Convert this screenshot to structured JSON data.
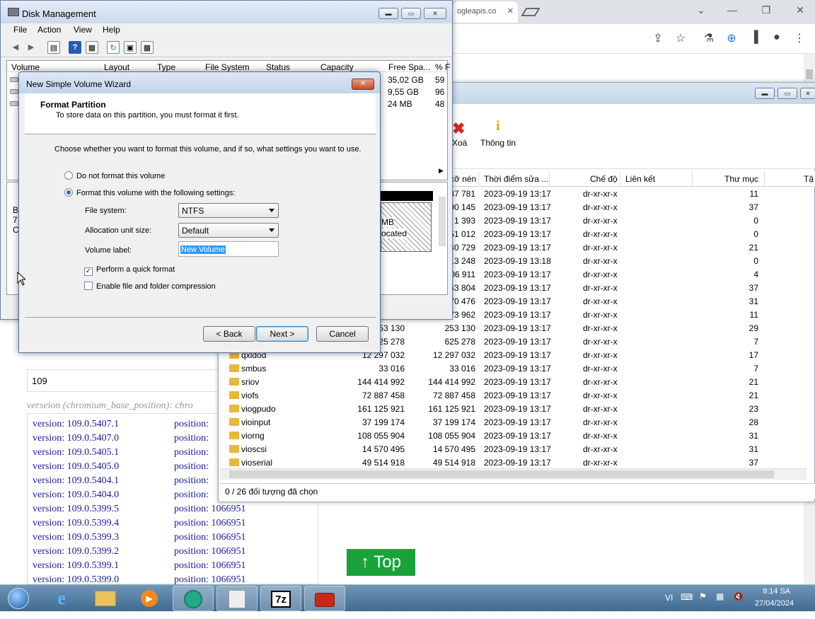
{
  "chrome": {
    "tab_text": "ogleapis.co",
    "controls": [
      "⌄",
      "—",
      "❐",
      "✕"
    ]
  },
  "page": {
    "input_value": "109",
    "italic_header": "verseion (chromium_base_position): chro",
    "versions": [
      {
        "version": "version: 109.0.5407.1",
        "position": "position:"
      },
      {
        "version": "version: 109.0.5407.0",
        "position": "position:"
      },
      {
        "version": "version: 109.0.5405.1",
        "position": "position:"
      },
      {
        "version": "version: 109.0.5405.0",
        "position": "position:"
      },
      {
        "version": "version: 109.0.5404.1",
        "position": "position:"
      },
      {
        "version": "version: 109.0.5404.0",
        "position": "position:"
      },
      {
        "version": "version: 109.0.5399.5",
        "position": "position: 1066951"
      },
      {
        "version": "version: 109.0.5399.4",
        "position": "position: 1066951"
      },
      {
        "version": "version: 109.0.5399.3",
        "position": "position: 1066951"
      },
      {
        "version": "version: 109.0.5399.2",
        "position": "position: 1066951"
      },
      {
        "version": "version: 109.0.5399.1",
        "position": "position: 1066951"
      },
      {
        "version": "version: 109.0.5399.0",
        "position": "position: 1066951"
      }
    ],
    "top_button": "↑ Top"
  },
  "file_manager": {
    "toolbar": {
      "delete_label": "Xoá",
      "info_label": "Thông tin"
    },
    "columns": [
      "cỡ nén",
      "Thời điểm sửa ...",
      "Chế độ",
      "Liên kết",
      "Thư mục",
      "Tậ"
    ],
    "rows_partial": [
      {
        "packed": "37 781",
        "time": "2023-09-19 13:17",
        "mode": "dr-xr-xr-x",
        "folders": "11"
      },
      {
        "packed": "00 145",
        "time": "2023-09-19 13:17",
        "mode": "dr-xr-xr-x",
        "folders": "37"
      },
      {
        "packed": "1 393",
        "time": "2023-09-19 13:17",
        "mode": "dr-xr-xr-x",
        "folders": "0"
      },
      {
        "packed": "51 012",
        "time": "2023-09-19 13:17",
        "mode": "dr-xr-xr-x",
        "folders": "0"
      },
      {
        "packed": "40 729",
        "time": "2023-09-19 13:17",
        "mode": "dr-xr-xr-x",
        "folders": "21"
      },
      {
        "packed": "13 248",
        "time": "2023-09-19 13:18",
        "mode": "dr-xr-xr-x",
        "folders": "0"
      },
      {
        "packed": "06 911",
        "time": "2023-09-19 13:17",
        "mode": "dr-xr-xr-x",
        "folders": "4"
      },
      {
        "packed": "43 804",
        "time": "2023-09-19 13:17",
        "mode": "dr-xr-xr-x",
        "folders": "37"
      },
      {
        "packed": "70 476",
        "time": "2023-09-19 13:17",
        "mode": "dr-xr-xr-x",
        "folders": "31"
      },
      {
        "packed": "73 962",
        "time": "2023-09-19 13:17",
        "mode": "dr-xr-xr-x",
        "folders": "11"
      },
      {
        "size": "253 130",
        "packed": "253 130",
        "time": "2023-09-19 13:17",
        "mode": "dr-xr-xr-x",
        "folders": "29"
      },
      {
        "size": "625 278",
        "packed": "625 278",
        "time": "2023-09-19 13:17",
        "mode": "dr-xr-xr-x",
        "folders": "7"
      }
    ],
    "rows": [
      {
        "name": "qxldod",
        "size": "12 297 032",
        "packed": "12 297 032",
        "time": "2023-09-19 13:17",
        "mode": "dr-xr-xr-x",
        "folders": "17"
      },
      {
        "name": "smbus",
        "size": "33 016",
        "packed": "33 016",
        "time": "2023-09-19 13:17",
        "mode": "dr-xr-xr-x",
        "folders": "7"
      },
      {
        "name": "sriov",
        "size": "144 414 992",
        "packed": "144 414 992",
        "time": "2023-09-19 13:17",
        "mode": "dr-xr-xr-x",
        "folders": "21"
      },
      {
        "name": "viofs",
        "size": "72 887 458",
        "packed": "72 887 458",
        "time": "2023-09-19 13:17",
        "mode": "dr-xr-xr-x",
        "folders": "21"
      },
      {
        "name": "viogpudo",
        "size": "161 125 921",
        "packed": "161 125 921",
        "time": "2023-09-19 13:17",
        "mode": "dr-xr-xr-x",
        "folders": "23"
      },
      {
        "name": "vioinput",
        "size": "37 199 174",
        "packed": "37 199 174",
        "time": "2023-09-19 13:17",
        "mode": "dr-xr-xr-x",
        "folders": "28"
      },
      {
        "name": "viorng",
        "size": "108 055 904",
        "packed": "108 055 904",
        "time": "2023-09-19 13:17",
        "mode": "dr-xr-xr-x",
        "folders": "31"
      },
      {
        "name": "vioscsi",
        "size": "14 570 495",
        "packed": "14 570 495",
        "time": "2023-09-19 13:17",
        "mode": "dr-xr-xr-x",
        "folders": "31"
      },
      {
        "name": "vioserial",
        "size": "49 514 918",
        "packed": "49 514 918",
        "time": "2023-09-19 13:17",
        "mode": "dr-xr-xr-x",
        "folders": "37"
      }
    ],
    "status": "0 / 26 đối tượng đã chọn"
  },
  "disk_management": {
    "title": "Disk Management",
    "menu": [
      "File",
      "Action",
      "View",
      "Help"
    ],
    "columns": [
      "Volume",
      "Layout",
      "Type",
      "File System",
      "Status",
      "Capacity",
      "Free Spa...",
      "% F"
    ],
    "rows": [
      {
        "free": "35,02 GB",
        "pct": "59"
      },
      {
        "free": "9,55 GB",
        "pct": "96"
      },
      {
        "free": "24 MB",
        "pct": "48"
      }
    ],
    "graph_fragments": {
      "mb": "MB",
      "alloc": "ocated",
      "left_b": "B",
      "left_7": "7",
      "left_c": "C"
    }
  },
  "wizard": {
    "title": "New Simple Volume Wizard",
    "heading": "Format Partition",
    "subheading": "To store data on this partition, you must format it first.",
    "instruction": "Choose whether you want to format this volume, and if so, what settings you want to use.",
    "radio_no_format": "Do not format this volume",
    "radio_format": "Format this volume with the following settings:",
    "fs_label": "File system:",
    "fs_value": "NTFS",
    "alloc_label": "Allocation unit size:",
    "alloc_value": "Default",
    "vol_label": "Volume label:",
    "vol_value": "New Volume",
    "quick_format": "Perform a quick format",
    "compression": "Enable file and folder compression",
    "back": "< Back",
    "next": "Next >",
    "cancel": "Cancel"
  },
  "taskbar": {
    "lang": "VI",
    "time": "9:14 SA",
    "date": "27/04/2024"
  }
}
